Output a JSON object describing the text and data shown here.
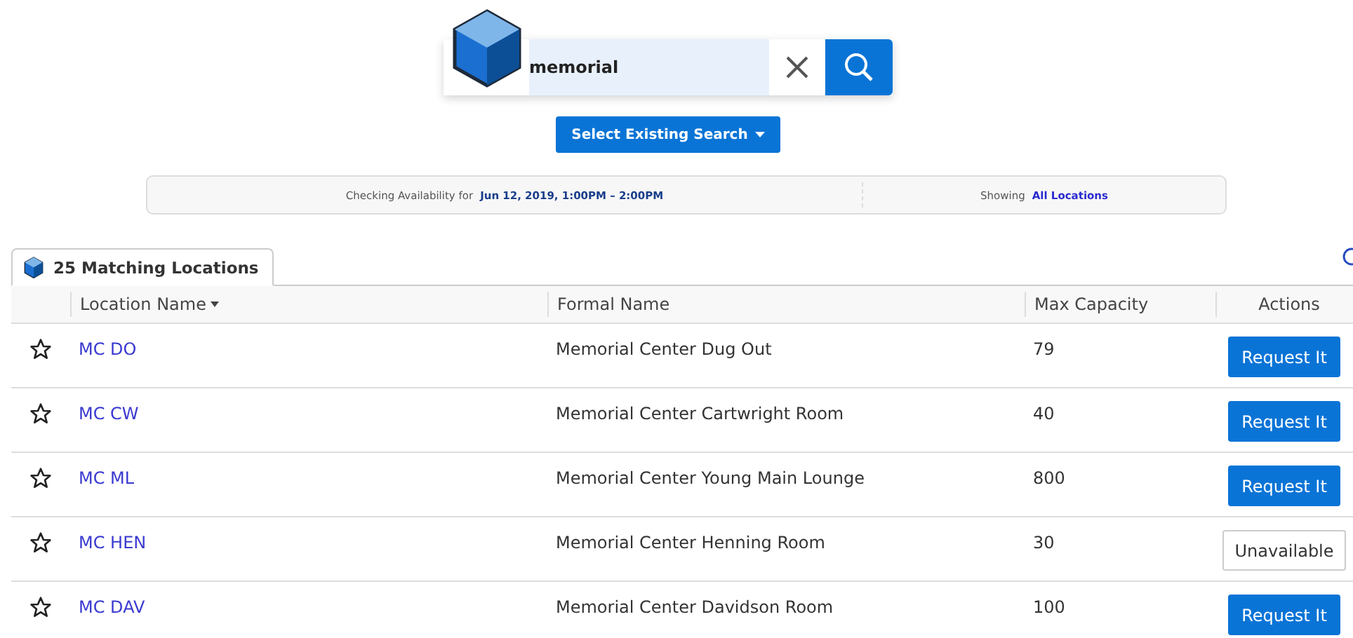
{
  "search": {
    "value": "memorial"
  },
  "select_search_button": {
    "label": "Select Existing Search"
  },
  "info_bar": {
    "availability_label": "Checking Availability for",
    "availability_value": "Jun 12, 2019, 1:00PM – 2:00PM",
    "showing_label": "Showing",
    "showing_value": "All Locations"
  },
  "results_tab": {
    "label": "25 Matching Locations",
    "selected": true
  },
  "table": {
    "columns": [
      "Location Name",
      "Formal Name",
      "Max Capacity",
      "Actions"
    ],
    "rows": [
      {
        "favorite": false,
        "name": "MC DO",
        "formal_name": "Memorial Center Dug Out",
        "capacity": "79",
        "action": {
          "kind": "request",
          "label": "Request It"
        }
      },
      {
        "favorite": false,
        "name": "MC CW",
        "formal_name": "Memorial Center Cartwright Room",
        "capacity": "40",
        "action": {
          "kind": "request",
          "label": "Request It"
        }
      },
      {
        "favorite": false,
        "name": "MC ML",
        "formal_name": "Memorial Center Young Main Lounge",
        "capacity": "800",
        "action": {
          "kind": "request",
          "label": "Request It"
        }
      },
      {
        "favorite": false,
        "name": "MC HEN",
        "formal_name": "Memorial Center Henning Room",
        "capacity": "30",
        "action": {
          "kind": "unavailable",
          "label": "Unavailable"
        }
      },
      {
        "favorite": false,
        "name": "MC DAV",
        "formal_name": "Memorial Center Davidson Room",
        "capacity": "100",
        "action": {
          "kind": "request",
          "label": "Request It"
        }
      }
    ]
  }
}
